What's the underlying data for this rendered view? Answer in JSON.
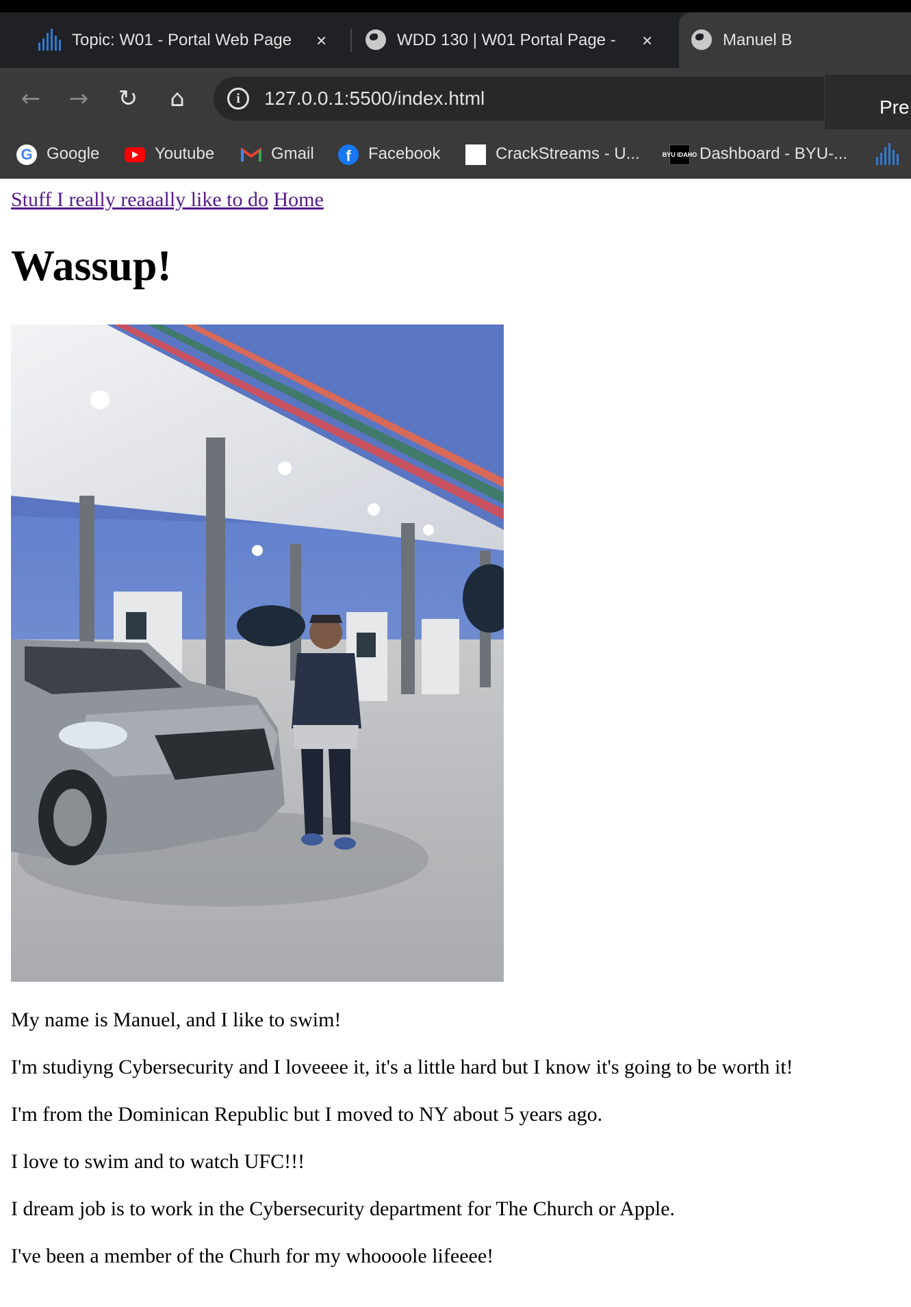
{
  "browser": {
    "tabs": [
      {
        "title": "Topic: W01 - Portal Web Page",
        "icon": "brightspace-bars-icon",
        "close": "×"
      },
      {
        "title": "WDD 130 | W01 Portal Page -",
        "icon": "globe-icon",
        "close": "×"
      },
      {
        "title": "Manuel B",
        "icon": "globe-icon",
        "active": true
      }
    ],
    "nav": {
      "back": "←",
      "forward": "→",
      "reload": "↻",
      "home": "⌂"
    },
    "address": {
      "info": "i",
      "url": "127.0.0.1:5500/index.html"
    },
    "preview_popup": "Pre",
    "bookmarks": [
      {
        "label": "Google",
        "icon": "google-icon"
      },
      {
        "label": "Youtube",
        "icon": "youtube-icon"
      },
      {
        "label": "Gmail",
        "icon": "gmail-icon"
      },
      {
        "label": "Facebook",
        "icon": "facebook-icon"
      },
      {
        "label": "CrackStreams - U...",
        "icon": "blank-page-icon"
      },
      {
        "label": "Dashboard - BYU-...",
        "icon": "byu-idaho-icon"
      }
    ],
    "byu_icon_text": "BYU IDAHO",
    "colors": {
      "chrome_dark": "#202124",
      "toolbar": "#3a3a3a",
      "visited_link": "#551a8b"
    }
  },
  "page": {
    "nav_links": [
      "Stuff I really reaaally like to do",
      "Home"
    ],
    "title": "Wassup!",
    "photo_alt": "Manuel standing next to a grey SUV at a gas station",
    "paragraphs": [
      "My name is Manuel, and I like to swim!",
      "I'm studiyng Cybersecurity and I loveeee it, it's a little hard but I know it's going to be worth it!",
      "I'm from the Dominican Republic but I moved to NY about 5 years ago.",
      "I love to swim and to watch UFC!!!",
      "I dream job is to work in the Cybersecurity department for The Church or Apple.",
      "I've been a member of the Churh for my whoooole lifeeee!"
    ]
  }
}
